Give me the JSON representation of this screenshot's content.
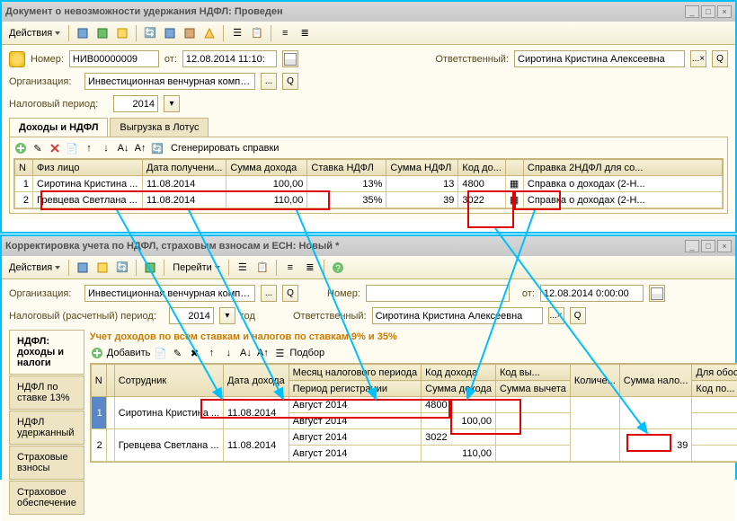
{
  "win1": {
    "title": "Документ о невозможности удержания НДФЛ: Проведен",
    "actions_label": "Действия",
    "fields": {
      "number_label": "Номер:",
      "number_value": "НИВ00000009",
      "from_label": "от:",
      "date_value": "12.08.2014 11:10:",
      "responsible_label": "Ответственный:",
      "responsible_value": "Сиротина Кристина Алексеевна",
      "org_label": "Организация:",
      "org_value": "Инвестиционная венчурная компани",
      "period_label": "Налоговый период:",
      "period_value": "2014"
    },
    "tabs": [
      "Доходы и НДФЛ",
      "Выгрузка в Лотус"
    ],
    "gen_button": "Сгенерировать справки",
    "grid": {
      "headers": [
        "N",
        "Физ лицо",
        "Дата получени...",
        "Сумма дохода",
        "Ставка НДФЛ",
        "Сумма НДФЛ",
        "Код до...",
        "",
        "Справка 2НДФЛ для со..."
      ],
      "rows": [
        {
          "n": "1",
          "person": "Сиротина Кристина ...",
          "date": "11.08.2014",
          "income": "100,00",
          "rate": "13%",
          "ndfl": "13",
          "code": "4800",
          "ref": "Справка о доходах (2-Н..."
        },
        {
          "n": "2",
          "person": "Гревцева Светлана ...",
          "date": "11.08.2014",
          "income": "110,00",
          "rate": "35%",
          "ndfl": "39",
          "code": "3022",
          "ref": "Справка о доходах (2-Н..."
        }
      ]
    }
  },
  "win2": {
    "title": "Корректировка учета по НДФЛ, страховым взносам и ЕСН: Новый *",
    "actions_label": "Действия",
    "go_label": "Перейти",
    "fields": {
      "org_label": "Организация:",
      "org_value": "Инвестиционная венчурная компани",
      "number_label": "Номер:",
      "number_value": "",
      "from_label": "от:",
      "date_value": "12.08.2014 0:00:00",
      "period_label": "Налоговый (расчетный) период:",
      "period_value": "2014",
      "god_label": "год",
      "responsible_label": "Ответственный:",
      "responsible_value": "Сиротина Кристина Алексеевна"
    },
    "side_tabs": [
      "НДФЛ: доходы и налоги",
      "НДФЛ по ставке 13%",
      "НДФЛ удержанный",
      "Страховые взносы",
      "Страховое обеспечение"
    ],
    "orange_header": "Учет доходов по всем ставкам и налогов по ставкам 9% и 35%",
    "add_label": "Добавить",
    "sel_label": "Подбор",
    "grid": {
      "headers1": [
        "N",
        "",
        "Сотрудник",
        "Дата дохода",
        "Месяц налогового периода",
        "Код дохода",
        "Код вы...",
        "Количе...",
        "Сумма нало...",
        "Для обос"
      ],
      "headers2": [
        "",
        "",
        "",
        "",
        "Период регистрации",
        "Сумма дохода",
        "Сумма вычета",
        "",
        "",
        "Код по..."
      ],
      "rows": [
        {
          "n": "1",
          "person": "Сиротина Кристина ...",
          "date": "11.08.2014",
          "month": "Август 2014",
          "code": "4800",
          "qty": "",
          "tax": ""
        },
        {
          "sub": true,
          "month": "Август 2014",
          "income": "100,00"
        },
        {
          "n": "2",
          "person": "Гревцева Светлана ...",
          "date": "11.08.2014",
          "month": "Август 2014",
          "code": "3022",
          "qty": "",
          "tax": "39"
        },
        {
          "sub": true,
          "month": "Август 2014",
          "income": "110,00"
        }
      ]
    }
  }
}
